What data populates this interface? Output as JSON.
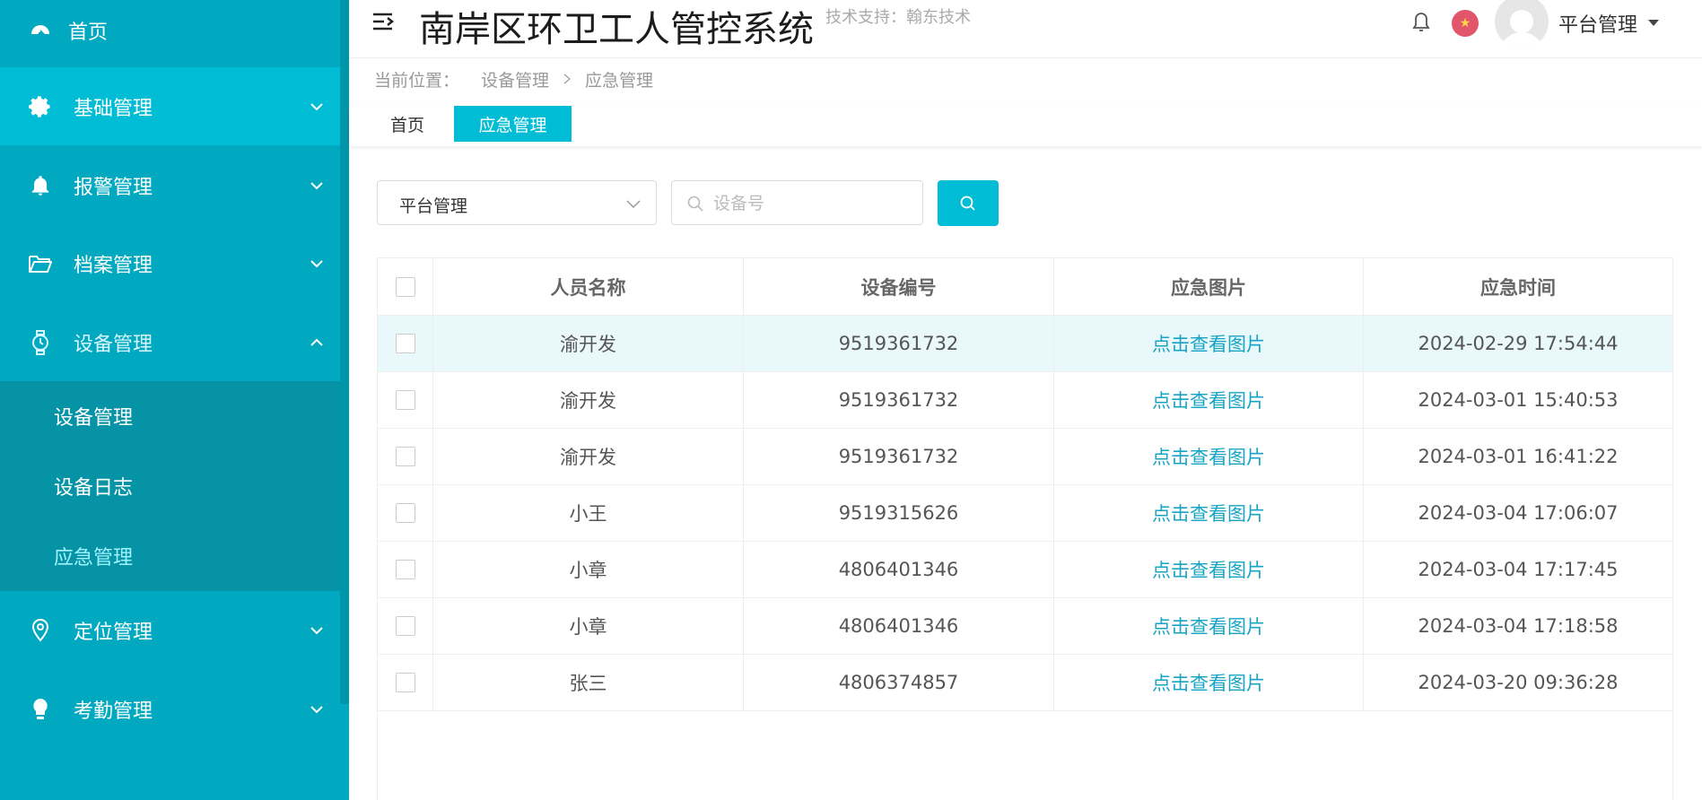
{
  "sidebar": {
    "items": [
      {
        "label": "首页",
        "icon": "dashboard-icon"
      },
      {
        "label": "基础管理",
        "icon": "gear-icon"
      },
      {
        "label": "报警管理",
        "icon": "bell-icon"
      },
      {
        "label": "档案管理",
        "icon": "folder-icon"
      },
      {
        "label": "设备管理",
        "icon": "watch-icon"
      },
      {
        "label": "定位管理",
        "icon": "location-pin-icon"
      },
      {
        "label": "考勤管理",
        "icon": "bulb-icon"
      }
    ],
    "submenu": [
      {
        "label": "设备管理"
      },
      {
        "label": "设备日志"
      },
      {
        "label": "应急管理"
      }
    ]
  },
  "header": {
    "title": "南岸区环卫工人管控系统",
    "tech_support": "技术支持：翰东技术",
    "user": "平台管理"
  },
  "breadcrumb": {
    "prefix": "当前位置：",
    "level1": "设备管理",
    "level2": "应急管理"
  },
  "tabs": {
    "home": "首页",
    "active": "应急管理"
  },
  "filter": {
    "select_value": "平台管理",
    "search_placeholder": "设备号"
  },
  "table": {
    "columns": [
      "人员名称",
      "设备编号",
      "应急图片",
      "应急时间"
    ],
    "rows": [
      {
        "name": "渝开发",
        "device": "9519361732",
        "image": "点击查看图片",
        "time": "2024-02-29 17:54:44"
      },
      {
        "name": "渝开发",
        "device": "9519361732",
        "image": "点击查看图片",
        "time": "2024-03-01 15:40:53"
      },
      {
        "name": "渝开发",
        "device": "9519361732",
        "image": "点击查看图片",
        "time": "2024-03-01 16:41:22"
      },
      {
        "name": "小王",
        "device": "9519315626",
        "image": "点击查看图片",
        "time": "2024-03-04 17:06:07"
      },
      {
        "name": "小章",
        "device": "4806401346",
        "image": "点击查看图片",
        "time": "2024-03-04 17:17:45"
      },
      {
        "name": "小章",
        "device": "4806401346",
        "image": "点击查看图片",
        "time": "2024-03-04 17:18:58"
      },
      {
        "name": "张三",
        "device": "4806374857",
        "image": "点击查看图片",
        "time": "2024-03-20 09:36:28"
      }
    ]
  },
  "colors": {
    "sidebar": "#00a9bf",
    "accent": "#00bcd4",
    "link": "#17a4c4"
  }
}
